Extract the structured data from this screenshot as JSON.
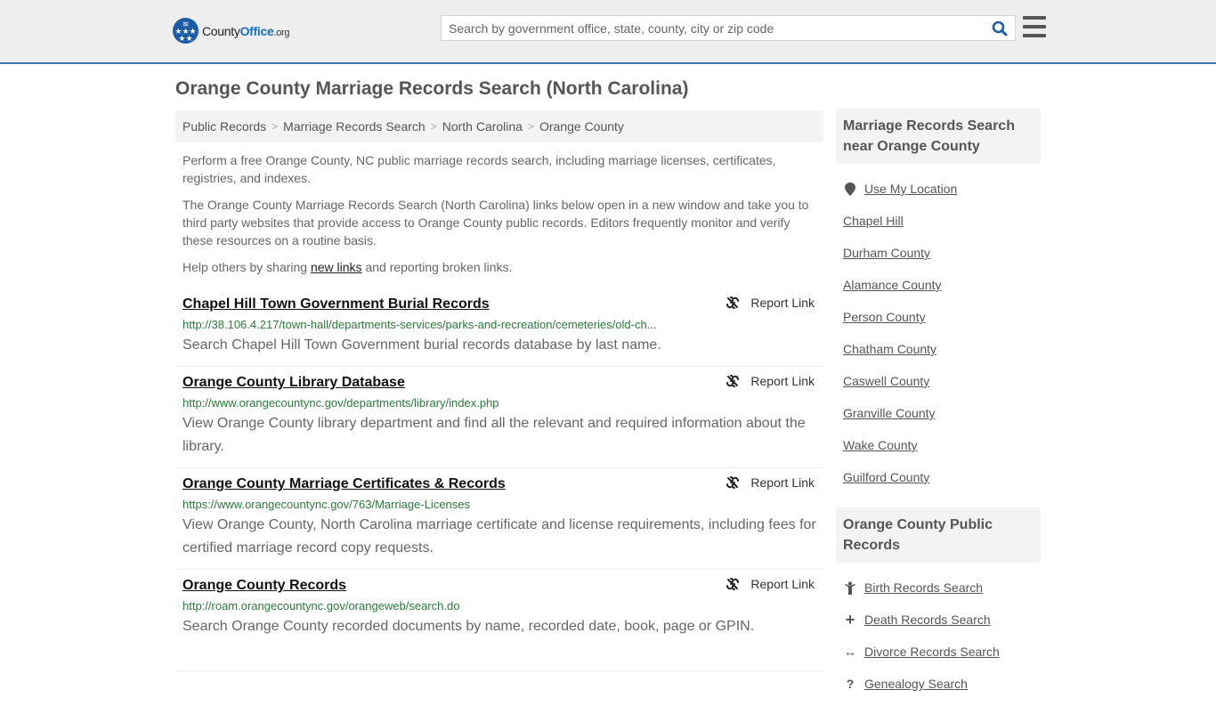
{
  "header": {
    "logo": {
      "name_part1": "County",
      "name_part2": "Office",
      "name_part3": ".org"
    },
    "search": {
      "placeholder": "Search by government office, state, county, city or zip code",
      "value": ""
    }
  },
  "page_title": "Orange County Marriage Records Search (North Carolina)",
  "breadcrumb": [
    "Public Records",
    "Marriage Records Search",
    "North Carolina",
    "Orange County"
  ],
  "intro": {
    "p1": "Perform a free Orange County, NC public marriage records search, including marriage licenses, certificates, registries, and indexes.",
    "p2": "The Orange County Marriage Records Search (North Carolina) links below open in a new window and take you to third party websites that provide access to Orange County public records. Editors frequently monitor and verify these resources on a routine basis.",
    "p3_before": "Help others by sharing ",
    "p3_link": "new links",
    "p3_after": " and reporting broken links."
  },
  "report_label": "Report Link",
  "results": [
    {
      "title": "Chapel Hill Town Government Burial Records",
      "url": "http://38.106.4.217/town-hall/departments-services/parks-and-recreation/cemeteries/old-ch...",
      "desc": "Search Chapel Hill Town Government burial records database by last name."
    },
    {
      "title": "Orange County Library Database",
      "url": "http://www.orangecountync.gov/departments/library/index.php",
      "desc": "View Orange County library department and find all the relevant and required information about the library."
    },
    {
      "title": "Orange County Marriage Certificates & Records",
      "url": "https://www.orangecountync.gov/763/Marriage-Licenses",
      "desc": "View Orange County, North Carolina marriage certificate and license requirements, including fees for certified marriage record copy requests."
    },
    {
      "title": "Orange County Records",
      "url": "http://roam.orangecountync.gov/orangeweb/search.do",
      "desc": "Search Orange County recorded documents by name, recorded date, book, page or GPIN."
    }
  ],
  "sidebar": {
    "nearby": {
      "heading": "Marriage Records Search near Orange County",
      "use_location": "Use My Location",
      "items": [
        "Chapel Hill",
        "Durham County",
        "Alamance County",
        "Person County",
        "Chatham County",
        "Caswell County",
        "Granville County",
        "Wake County",
        "Guilford County"
      ]
    },
    "public_records": {
      "heading": "Orange County Public Records",
      "items": [
        {
          "label": "Birth Records Search",
          "icon": "child-icon"
        },
        {
          "label": "Death Records Search",
          "icon": "cross-icon"
        },
        {
          "label": "Divorce Records Search",
          "icon": "arrows-horizontal-icon"
        },
        {
          "label": "Genealogy Search",
          "icon": "question-icon"
        }
      ]
    }
  }
}
